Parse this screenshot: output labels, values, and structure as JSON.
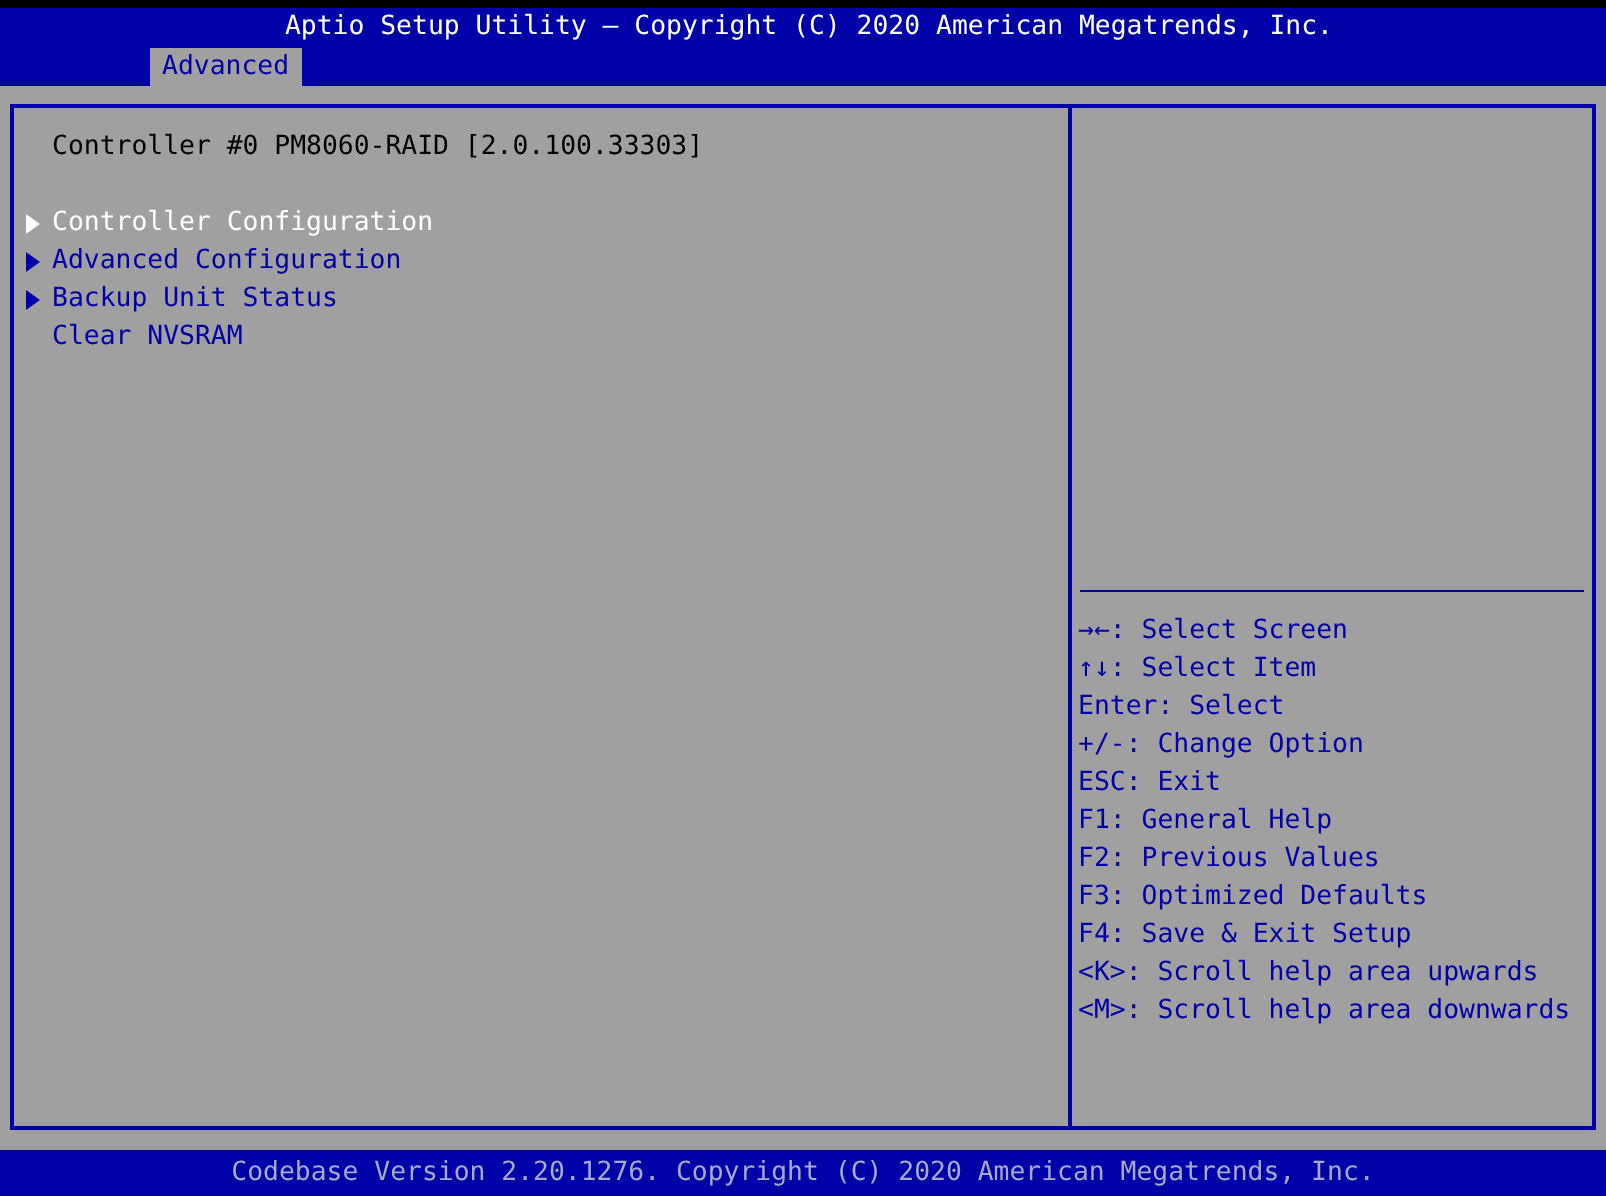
{
  "header": {
    "title": "Aptio Setup Utility – Copyright (C) 2020 American Megatrends, Inc."
  },
  "tabs": [
    {
      "label": "Advanced",
      "selected": true
    }
  ],
  "main": {
    "heading": "Controller #0 PM8060-RAID [2.0.100.33303]",
    "items": [
      {
        "label": "Controller Configuration",
        "kind": "submenu",
        "selected": true
      },
      {
        "label": "Advanced Configuration",
        "kind": "submenu",
        "selected": false
      },
      {
        "label": "Backup Unit Status",
        "kind": "submenu",
        "selected": false
      },
      {
        "label": "Clear NVSRAM",
        "kind": "action",
        "selected": false
      }
    ]
  },
  "help": [
    "→←: Select Screen",
    "↑↓: Select Item",
    "Enter: Select",
    "+/-: Change Option",
    "ESC: Exit",
    "F1: General Help",
    "F2: Previous Values",
    "F3: Optimized Defaults",
    "F4: Save & Exit Setup",
    "<K>: Scroll help area upwards",
    "<M>: Scroll help area downwards"
  ],
  "footer": "Codebase Version 2.20.1276. Copyright (C) 2020 American Megatrends, Inc."
}
